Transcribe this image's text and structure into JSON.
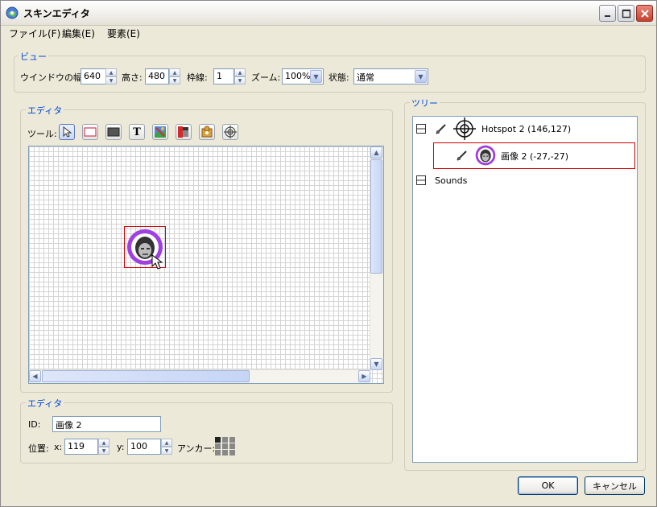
{
  "window": {
    "title": "スキンエディタ"
  },
  "menu": [
    "ファイル(F)",
    "編集(E)",
    "要素(E)"
  ],
  "view_group": {
    "title": "ビュー",
    "window_width_label": "ウインドウの幅:",
    "window_width_value": "640",
    "height_label": "高さ:",
    "height_value": "480",
    "border_label": "枠線:",
    "border_value": "1",
    "zoom_label": "ズーム:",
    "zoom_value": "100%",
    "state_label": "状態:",
    "state_value": "通常"
  },
  "editor_group": {
    "title": "エディタ",
    "tools_label": "ツール:",
    "tools": [
      "select-pointer-icon",
      "rectangle-outline-icon",
      "rectangle-filled-icon",
      "text-icon",
      "image-icon",
      "hotspot-image-icon",
      "puzzle-icon",
      "crosshair-icon"
    ],
    "text_tool_glyph": "T"
  },
  "properties_group": {
    "title": "エディタ",
    "id_label": "ID:",
    "id_value": "画像 2",
    "position_label": "位置:",
    "x_label": "x:",
    "x_value": "119",
    "y_label": "y:",
    "y_value": "100",
    "anchor_label": "アンカー:"
  },
  "tree_group": {
    "title": "ツリー",
    "nodes": [
      {
        "label": "Hotspot 2 (146,127)",
        "icon": "crosshair-icon"
      },
      {
        "label": "画像 2 (-27,-27)",
        "icon": "buddha-image-icon"
      },
      {
        "label": "Sounds",
        "icon": ""
      }
    ]
  },
  "buttons": {
    "ok": "OK",
    "cancel": "キャンセル"
  },
  "colors": {
    "accent": "#0046d5",
    "selection": "#d40000",
    "image_ring": "#a040e0"
  }
}
